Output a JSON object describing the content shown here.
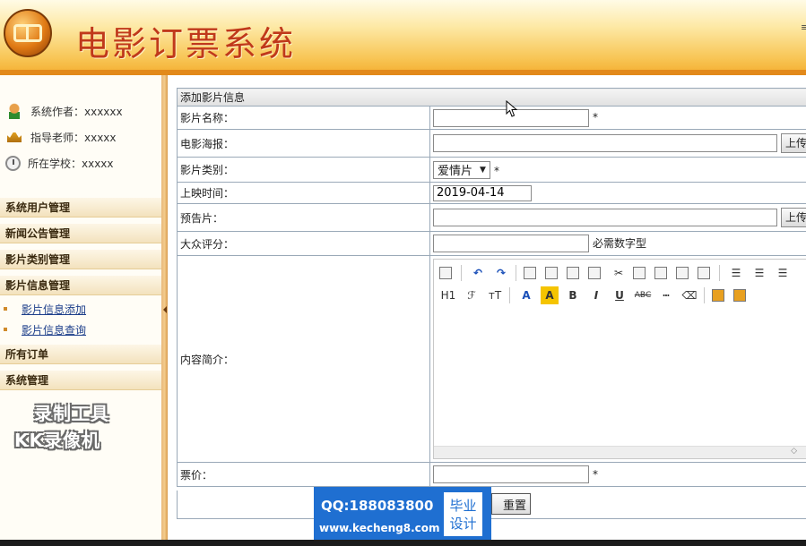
{
  "header": {
    "title": "电影订票系统",
    "edge_text": "≡"
  },
  "sidebar": {
    "info": [
      {
        "icon": "user-icon",
        "text": "系统作者：xxxxxx"
      },
      {
        "icon": "crown-icon",
        "text": "指导老师：xxxxx"
      },
      {
        "icon": "clock-icon",
        "text": "所在学校：xxxxx"
      }
    ],
    "menus": [
      {
        "label": "系统用户管理"
      },
      {
        "label": "新闻公告管理"
      },
      {
        "label": "影片类别管理"
      },
      {
        "label": "影片信息管理"
      }
    ],
    "submenu": [
      {
        "label": "影片信息添加"
      },
      {
        "label": "影片信息查询"
      }
    ],
    "menus_after": [
      {
        "label": "所有订单"
      },
      {
        "label": "系统管理"
      }
    ],
    "watermark": {
      "line1": "录制工具",
      "line2": "KK录像机"
    }
  },
  "form": {
    "caption": "添加影片信息",
    "fields": {
      "name": {
        "label": "影片名称：",
        "value": "",
        "required": "*"
      },
      "poster": {
        "label": "电影海报：",
        "value": "",
        "button": "上传"
      },
      "category": {
        "label": "影片类别：",
        "value": "爱情片",
        "required": "*"
      },
      "release": {
        "label": "上映时间：",
        "value": "2019-04-14"
      },
      "trailer": {
        "label": "预告片：",
        "value": "",
        "button": "上传"
      },
      "rating": {
        "label": "大众评分：",
        "value": "",
        "hint": "必需数字型"
      },
      "intro": {
        "label": "内容简介："
      },
      "price": {
        "label": "票价：",
        "value": "",
        "required": "*"
      }
    },
    "reset_label": "重置"
  },
  "editor": {
    "toolbar_row1": [
      "source-icon",
      "undo-icon",
      "redo-icon",
      "preview-icon",
      "print-icon",
      "template-icon",
      "paste-code-icon",
      "cut-icon",
      "copy-icon",
      "paste-icon",
      "paste-text-icon",
      "paste-word-icon",
      "align-left-icon",
      "align-center-icon",
      "align-right-icon"
    ],
    "toolbar_row2_labels": {
      "heading": "H1",
      "font": "ℱ",
      "size": "тT",
      "fore": "A",
      "hilite": "A",
      "bold": "B",
      "italic": "I",
      "underline": "U",
      "strike": "ABC"
    }
  },
  "overlay": {
    "qq": "QQ:188083800",
    "site": "www.kecheng8.com",
    "badge_line1": "毕业",
    "badge_line2": "设计"
  }
}
